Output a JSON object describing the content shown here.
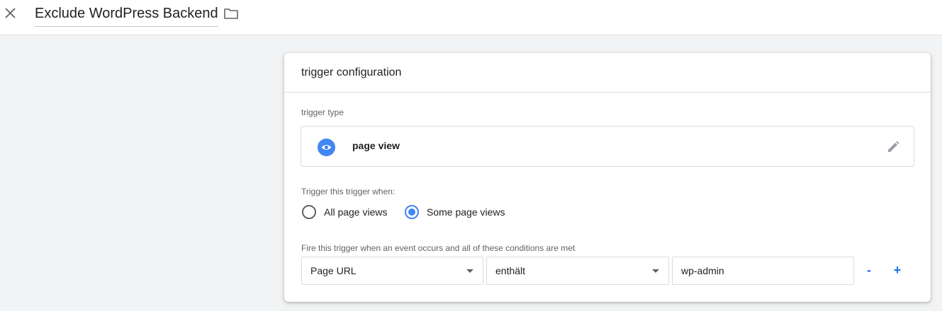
{
  "header": {
    "title": "Exclude WordPress Backend",
    "close_icon": "close-icon",
    "folder_icon": "folder-icon"
  },
  "card": {
    "title": "trigger configuration",
    "trigger_type_label": "trigger type",
    "trigger_type": {
      "label": "page view",
      "icon": "eye-icon",
      "edit_icon": "pencil-icon"
    },
    "trigger_when_label": "Trigger this trigger when:",
    "radio_options": [
      {
        "label": "All page views",
        "selected": false
      },
      {
        "label": "Some page views",
        "selected": true
      }
    ],
    "conditions_label": "Fire this trigger when an event occurs and all of these conditions are met",
    "condition": {
      "variable": "Page URL",
      "operator": "enthält",
      "value": "wp-admin"
    },
    "remove_label": "-",
    "add_label": "+"
  },
  "colors": {
    "accent": "#4285f4",
    "link": "#1a73e8",
    "background": "#f1f3f4",
    "text": "#202124",
    "muted": "#5f6368"
  }
}
